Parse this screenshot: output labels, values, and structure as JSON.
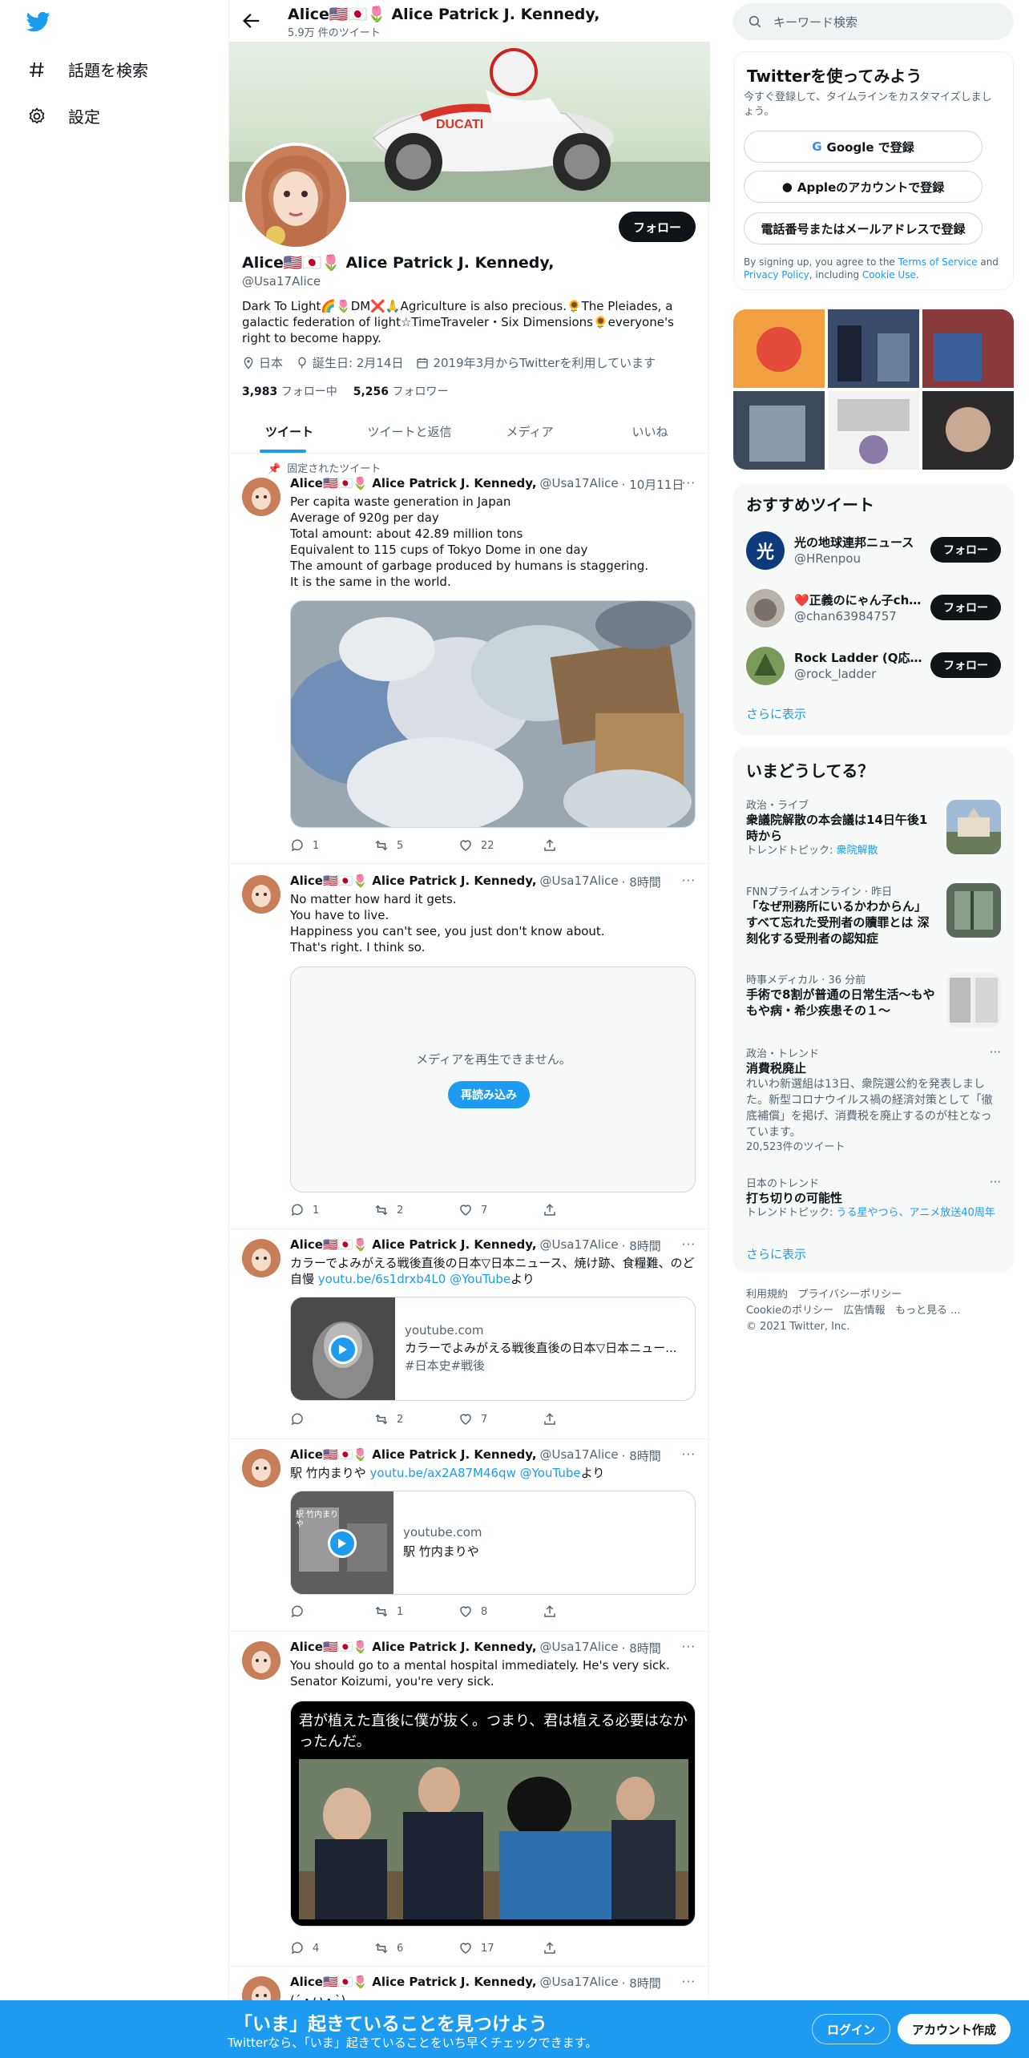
{
  "left_nav": {
    "items": [
      {
        "label": "話題を検索",
        "icon": "hash-icon"
      },
      {
        "label": "設定",
        "icon": "gear-icon"
      }
    ]
  },
  "header": {
    "name": "Alice🇺🇸🇯🇵🌷 Alice Patrick J. Kennedy,",
    "tweet_count": "5.9万 件のツイート"
  },
  "profile": {
    "follow_label": "フォロー",
    "name": "Alice🇺🇸🇯🇵🌷 Alice Patrick J. Kennedy,",
    "handle": "@Usa17Alice",
    "bio": "Dark To Light🌈🌷DM❌🙏Agriculture is also precious.🌻The Pleiades, a galactic federation of light☆TimeTraveler・Six Dimensions🌻everyone's right to become happy.",
    "location": "日本",
    "birthday": "誕生日: 2月14日",
    "joined": "2019年3月からTwitterを利用しています",
    "following_count": "3,983",
    "following_label": "フォロー中",
    "followers_count": "5,256",
    "followers_label": "フォロワー"
  },
  "tabs": [
    "ツイート",
    "ツイートと返信",
    "メディア",
    "いいね"
  ],
  "tweets": {
    "pinned_label": "固定されたツイート",
    "author": "Alice🇺🇸🇯🇵🌷 Alice Patrick J. Kennedy,",
    "handle": "@Usa17Alice",
    "t1": {
      "time": "· 10月11日",
      "lines": [
        "Per capita waste generation in Japan",
        "Average of 920g per day",
        "Total amount: about 42.89 million tons",
        "Equivalent to 115 cups of Tokyo Dome in one day",
        "The amount of garbage produced by humans is staggering.",
        "It is the same in the world."
      ],
      "replies": "1",
      "retweets": "5",
      "likes": "22"
    },
    "t2": {
      "time": "· 8時間",
      "lines": [
        "No matter how hard it gets.",
        "You have to live.",
        "Happiness you can't see, you just don't know about.",
        "That's right. I think so."
      ],
      "media_error": "メディアを再生できません。",
      "reload_label": "再読み込み",
      "replies": "1",
      "retweets": "2",
      "likes": "7"
    },
    "t3": {
      "time": "· 8時間",
      "text": "カラーでよみがえる戦後直後の日本▽日本ニュース、焼け跡、食糧難、のど自慢 ",
      "link": "youtu.be/6s1drxb4L0",
      "mention": "@YouTube",
      "suffix": "より",
      "card_domain": "youtube.com",
      "card_title": "カラーでよみがえる戦後直後の日本▽日本ニュー...",
      "card_desc": "#日本史#戦後",
      "replies": "",
      "retweets": "2",
      "likes": "7"
    },
    "t4": {
      "time": "· 8時間",
      "text": "駅  竹内まりや ",
      "link": "youtu.be/ax2A87M46qw",
      "mention": "@YouTube",
      "suffix": "より",
      "card_domain": "youtube.com",
      "card_title": "駅 竹内まりや",
      "thumb_text": "駅 竹内まりや",
      "replies": "",
      "retweets": "1",
      "likes": "8"
    },
    "t5": {
      "time": "· 8時間",
      "lines": [
        "You should go to a mental hospital immediately. He's very sick.",
        "Senator Koizumi, you're very sick."
      ],
      "image_caption": "君が植えた直後に僕が抜く。つまり、君は植える必要はなかったんだ。",
      "replies": "4",
      "retweets": "6",
      "likes": "17"
    },
    "t6": {
      "time": "· 8時間",
      "text": "(´・ω・`)"
    }
  },
  "right": {
    "search_placeholder": "キーワード検索",
    "signup": {
      "title": "Twitterを使ってみよう",
      "subtitle": "今すぐ登録して、タイムラインをカスタマイズしましょう。",
      "google": "Google で登録",
      "apple": "Appleのアカウントで登録",
      "phone": "電話番号またはメールアドレスで登録",
      "terms_pre": "By signing up, you agree to the ",
      "terms_link": "Terms of Service",
      "terms_and": " and ",
      "privacy_link": "Privacy Policy",
      "terms_mid": ", including ",
      "cookie_link": "Cookie Use",
      "terms_end": "."
    },
    "recommend": {
      "title": "おすすめツイート",
      "items": [
        {
          "name": "光の地球連邦ニュース",
          "handle": "@HRenpou",
          "btn": "フォロー"
        },
        {
          "name": "❤️正義のにゃん子ch...",
          "handle": "@chan63984757",
          "btn": "フォロー"
        },
        {
          "name": "Rock Ladder (Q応援...",
          "handle": "@rock_ladder",
          "btn": "フォロー"
        }
      ],
      "more": "さらに表示"
    },
    "trends": {
      "title": "いまどうしてる？",
      "items": [
        {
          "cat": "政治・ライブ",
          "title": "衆議院解散の本会議は14日午後1時から",
          "sub_pre": "トレンドトピック: ",
          "sub_link": "衆院解散"
        },
        {
          "cat": "FNNプライムオンライン · 昨日",
          "title": "「なぜ刑務所にいるかわからん」すべて忘れた受刑者の贖罪とは 深刻化する受刑者の認知症"
        },
        {
          "cat": "時事メディカル · 36 分前",
          "title": "手術で8割が普通の日常生活～もやもや病・希少疾患その１～"
        },
        {
          "cat": "政治・トレンド",
          "title": "消費税廃止",
          "desc": "れいわ新選組は13日、衆院選公約を発表しました。新型コロナウイルス禍の経済対策として「徹底補償」を掲げ、消費税を廃止するのが柱となっています。",
          "count": "20,523件のツイート"
        },
        {
          "cat": "日本のトレンド",
          "title": "打ち切りの可能性",
          "sub_pre": "トレンドトピック: ",
          "sub_link": "うる星やつら、アニメ放送40周年"
        }
      ],
      "more": "さらに表示"
    },
    "footer": {
      "links": [
        "利用規約",
        "プライバシーポリシー",
        "Cookieのポリシー",
        "広告情報",
        "もっと見る ..."
      ],
      "copyright": "© 2021 Twitter, Inc."
    }
  },
  "bottom_bar": {
    "title": "「いま」起きていることを見つけよう",
    "subtitle": "Twitterなら、「いま」起きていることをいち早くチェックできます。",
    "login": "ログイン",
    "signup": "アカウント作成"
  },
  "colors": {
    "accent": "#1d9bf0",
    "text": "#0f1419",
    "secondary": "#536471",
    "like": "#f91880"
  }
}
